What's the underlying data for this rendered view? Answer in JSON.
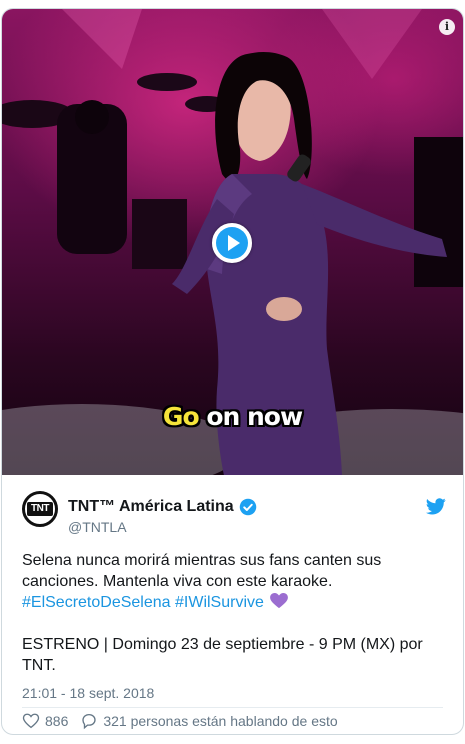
{
  "media": {
    "caption_highlight": "Go",
    "caption_rest": " on now",
    "info_glyph": "i",
    "play_icon": "play-icon"
  },
  "tweet": {
    "avatar_logo": "TNT",
    "display_name": "TNT™ América Latina",
    "verified_icon": "verified-badge-icon",
    "handle": "@TNTLA",
    "brand_icon": "twitter-bird-icon",
    "text_line1": "Selena nunca morirá mientras sus fans canten sus",
    "text_line2": "canciones. Mantenla viva con este karaoke.",
    "hashtag1": "#ElSecretoDeSelena",
    "hashtag2": "#IWilSurvive",
    "emoji_icon": "purple-heart-icon",
    "text_line4": "ESTRENO | Domingo 23 de septiembre - 9 PM (MX) por",
    "text_line5": "TNT.",
    "timestamp": "21:01 - 18 sept. 2018",
    "likes": "886",
    "replies": "321 personas están hablando de esto"
  },
  "colors": {
    "link": "#1b95e0",
    "twitter_blue": "#1da1f2",
    "muted": "#657786",
    "caption_highlight": "#f5e43a",
    "emoji_purple": "#9b6dd0"
  }
}
